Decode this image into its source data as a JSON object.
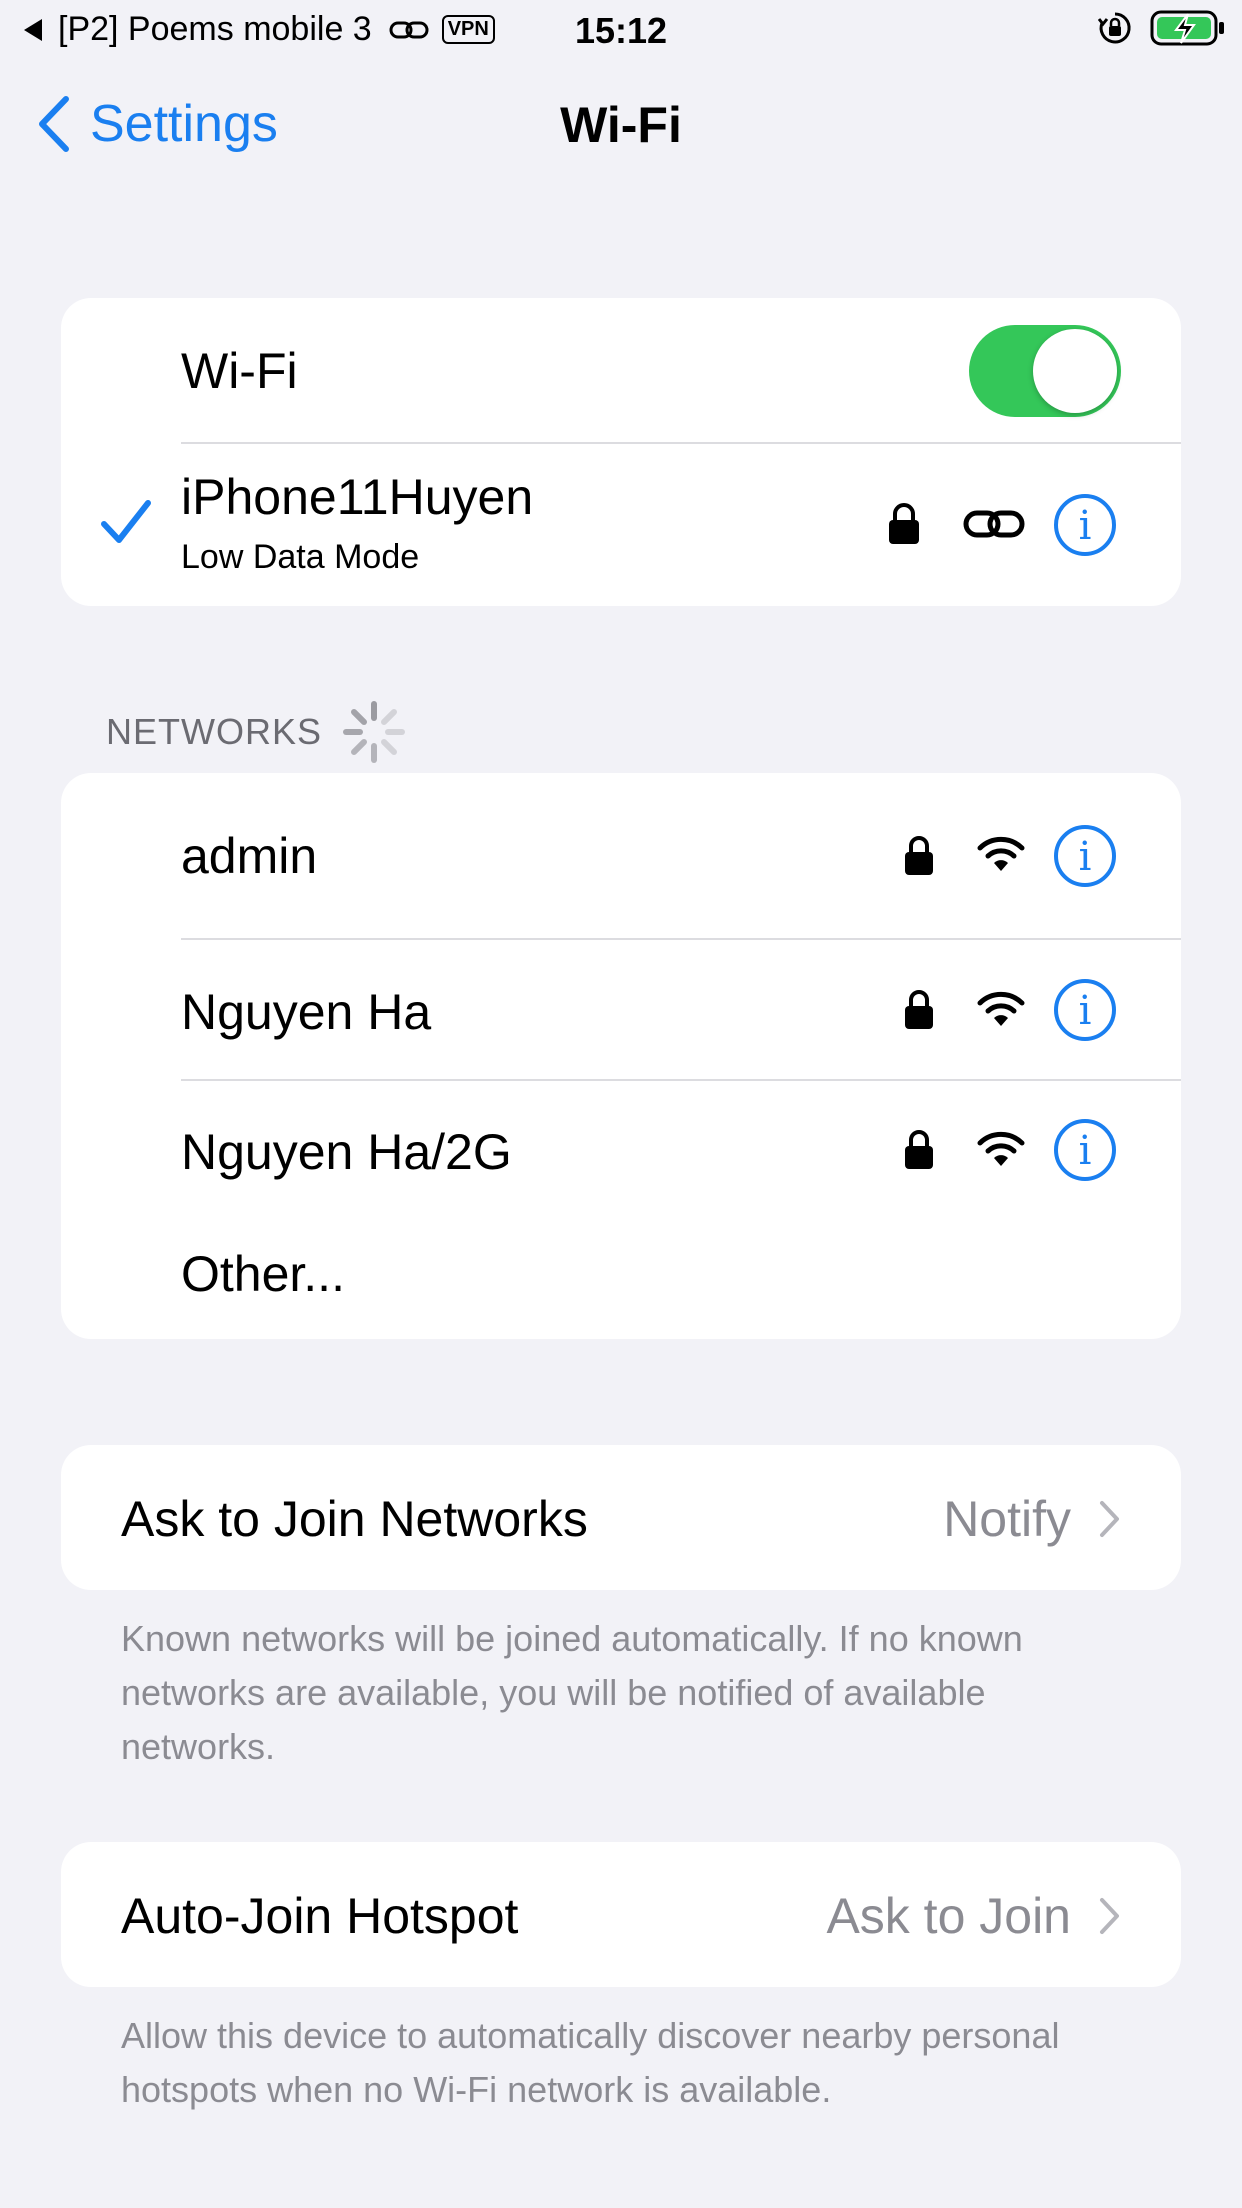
{
  "status_bar": {
    "back_app": "[P2] Poems mobile 3",
    "vpn": "VPN",
    "time": "15:12",
    "colors": {
      "battery": "#34c759"
    }
  },
  "nav": {
    "back_label": "Settings",
    "title": "Wi-Fi"
  },
  "wifi": {
    "toggle_label": "Wi-Fi",
    "toggle_on": true,
    "connected_network": "iPhone11Huyen",
    "connected_subtitle": "Low Data Mode"
  },
  "networks": {
    "header": "NETWORKS",
    "items": [
      {
        "name": "admin",
        "secured": true,
        "signal": "full"
      },
      {
        "name": "Nguyen Ha",
        "secured": true,
        "signal": "full"
      },
      {
        "name": "Nguyen Ha/2G",
        "secured": true,
        "signal": "full"
      }
    ],
    "other_label": "Other..."
  },
  "ask_to_join": {
    "label": "Ask to Join Networks",
    "value": "Notify",
    "footnote": "Known networks will be joined automatically. If no known networks are available, you will be notified of available networks."
  },
  "auto_join_hotspot": {
    "label": "Auto-Join Hotspot",
    "value": "Ask to Join",
    "footnote": "Allow this device to automatically discover nearby personal hotspots when no Wi-Fi network is available."
  },
  "colors": {
    "accent": "#1a7ff0",
    "toggle_on": "#34c759",
    "background": "#f2f2f7"
  }
}
